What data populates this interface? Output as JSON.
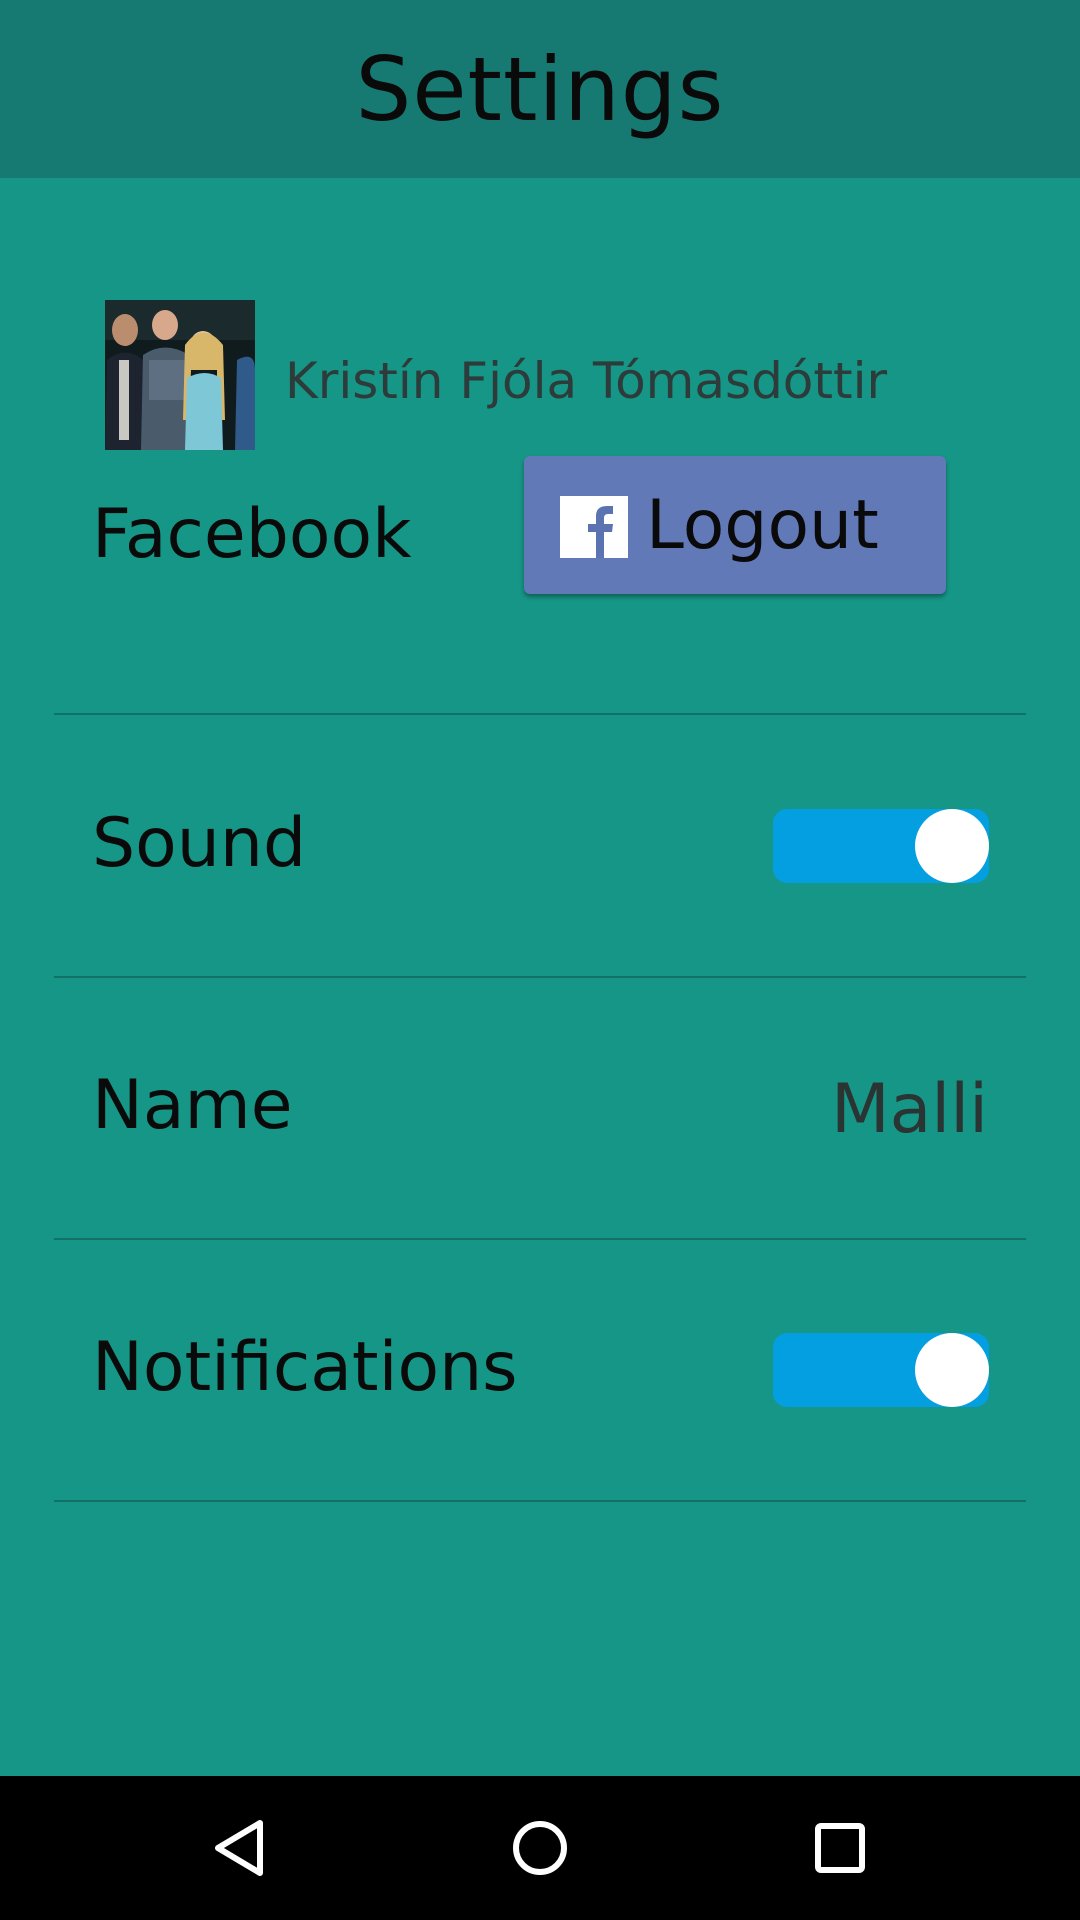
{
  "header": {
    "title": "Settings"
  },
  "profile": {
    "name": "Kristín Fjóla Tómasdóttir"
  },
  "facebook": {
    "label": "Facebook",
    "button_label": "Logout",
    "button_color": "#6179b6"
  },
  "sound": {
    "label": "Sound",
    "enabled": true
  },
  "name_row": {
    "label": "Name",
    "value": "Malli"
  },
  "notifications": {
    "label": "Notifications",
    "enabled": true
  },
  "colors": {
    "background": "#169686",
    "header": "#177a72",
    "toggle_on": "#049fe0"
  },
  "navbar": {
    "icons": [
      "back-icon",
      "home-icon",
      "recents-icon"
    ]
  }
}
